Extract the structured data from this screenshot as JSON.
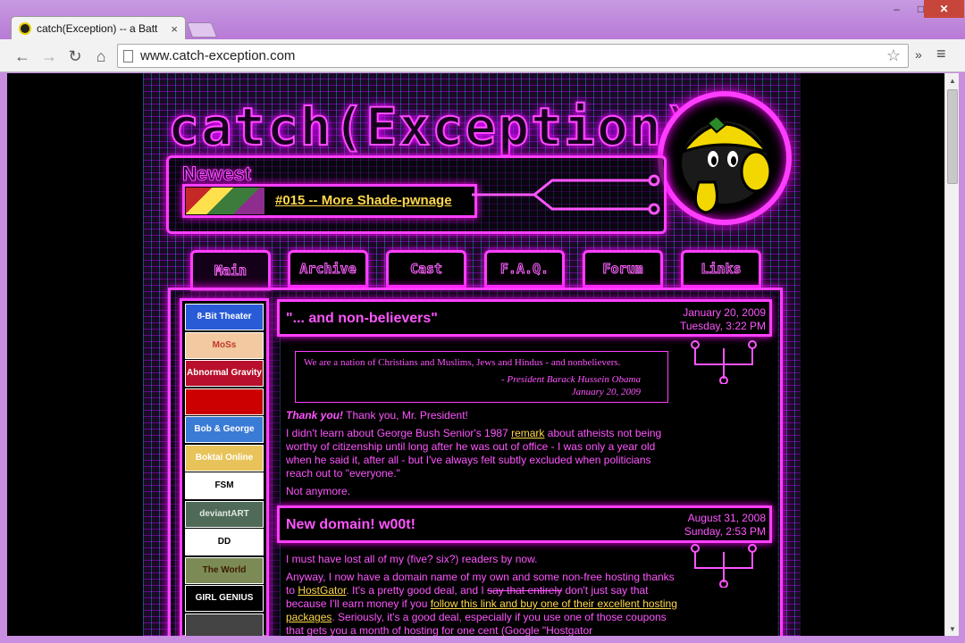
{
  "browser": {
    "tab_title": "catch(Exception) -- a Batt",
    "tab_close": "×",
    "url": "www.catch-exception.com",
    "overflow": "»",
    "menu": "≡",
    "window_controls": {
      "minimize": "–",
      "maximize": "□",
      "close": "✕"
    },
    "nav": {
      "back": "←",
      "forward": "→",
      "reload": "↻",
      "home": "⌂",
      "star": "☆"
    }
  },
  "site": {
    "logo": "catch(Exception)",
    "newest_label": "Newest",
    "newest_link": "#015 -- More Shade-pwnage",
    "nav_tabs": [
      "Main",
      "Archive",
      "Cast",
      "F.A.Q.",
      "Forum",
      "Links"
    ],
    "active_tab": "Main",
    "sidebar_links": [
      {
        "label": "8-Bit Theater",
        "bg": "#2a5bd7",
        "fg": "#ffffff"
      },
      {
        "label": "MoSs",
        "bg": "#f2c9a0",
        "fg": "#c03a2b"
      },
      {
        "label": "Abnormal Gravity",
        "bg": "#b8102c",
        "fg": "#ffffff"
      },
      {
        "label": "",
        "bg": "#cc0000",
        "fg": "#ffffff"
      },
      {
        "label": "Bob & George",
        "bg": "#3a7bd5",
        "fg": "#ffffff"
      },
      {
        "label": "Boktai Online",
        "bg": "#e8c35a",
        "fg": "#ffffff"
      },
      {
        "label": "FSM",
        "bg": "#ffffff",
        "fg": "#000000"
      },
      {
        "label": "deviantART",
        "bg": "#4f6b58",
        "fg": "#dfe8df"
      },
      {
        "label": "DD",
        "bg": "#ffffff",
        "fg": "#000000"
      },
      {
        "label": "The World",
        "bg": "#7c8a55",
        "fg": "#3c1a00"
      },
      {
        "label": "GIRL GENIUS",
        "bg": "#000000",
        "fg": "#ffffff"
      },
      {
        "label": "",
        "bg": "#444444",
        "fg": "#ffffff"
      }
    ],
    "posts": [
      {
        "title": "\"... and non-believers\"",
        "date": "January 20, 2009",
        "time": "Tuesday, 3:22 PM",
        "quote": "We are a nation of Christians and Muslims, Jews and Hindus - and nonbelievers.",
        "quote_attr": "- President Barack Hussein Obama",
        "quote_date": "January 20, 2009",
        "p1_bold": "Thank you!",
        "p1_rest": " Thank you, Mr. President!",
        "p2_a": "I didn't learn about George Bush Senior's 1987 ",
        "p2_link": "remark",
        "p2_b": " about atheists not being worthy of citizenship until long after he was out of office - I was only a year old when he said it, after all - but I've always felt subtly excluded when politicians reach out to \"everyone.\"",
        "p3": "Not anymore."
      },
      {
        "title": "New domain!  w00t!",
        "date": "August 31, 2008",
        "time": "Sunday, 2:53 PM",
        "p1": "I must have lost all of my (five? six?) readers by now.",
        "p2_a": "Anyway, I now have a domain name of my own and some non-free hosting thanks to ",
        "p2_link1": "HostGator",
        "p2_b": ".  It's a pretty good deal, and I ",
        "p2_strike": "say that entirely",
        "p2_c": " don't just say that because I'll earn money if you ",
        "p2_link2": "follow this link and buy one of their excellent hosting packages",
        "p2_d": ".  Seriously, it's a good deal, especially if you use one of those coupons that gets you a month of hosting for one cent (Google \"Hostgator"
      }
    ]
  }
}
